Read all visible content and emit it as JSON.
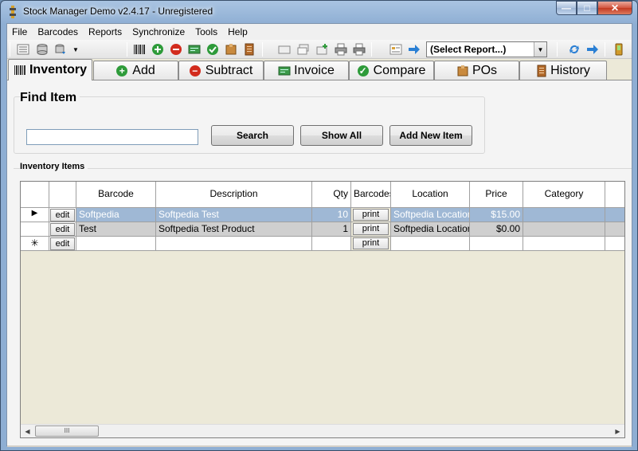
{
  "window": {
    "title": "Stock Manager Demo v2.4.17 - Unregistered",
    "min_label": "—",
    "max_label": "□",
    "close_label": "✕"
  },
  "menu": [
    "File",
    "Barcodes",
    "Reports",
    "Synchronize",
    "Tools",
    "Help"
  ],
  "toolbar": {
    "report_select": "(Select Report...)"
  },
  "tabs": [
    "Inventory",
    "Add",
    "Subtract",
    "Invoice",
    "Compare",
    "POs",
    "History"
  ],
  "find": {
    "title": "Find Item",
    "search_value": "",
    "search_button": "Search",
    "show_all_button": "Show All",
    "add_new_button": "Add New Item"
  },
  "inventory": {
    "title": "Inventory Items",
    "columns": [
      "",
      "",
      "Barcode",
      "Description",
      "Qty",
      "Barcodes",
      "Location",
      "Price",
      "Category"
    ],
    "rows": [
      {
        "marker": "▶",
        "edit": "edit",
        "barcode": "Softpedia",
        "description": "Softpedia Test",
        "qty": "10",
        "print": "print",
        "location": "Softpedia Location",
        "price": "$15.00",
        "category": ""
      },
      {
        "marker": "",
        "edit": "edit",
        "barcode": "Test",
        "description": "Softpedia Test Product",
        "qty": "1",
        "print": "print",
        "location": "Softpedia Location",
        "price": "$0.00",
        "category": ""
      },
      {
        "marker": "✳",
        "edit": "edit",
        "barcode": "",
        "description": "",
        "qty": "",
        "print": "print",
        "location": "",
        "price": "",
        "category": ""
      }
    ]
  },
  "scrollbar": {
    "left": "◀",
    "right": "▶",
    "grip": "III"
  },
  "colors": {
    "selected_row": "#9fb8d5",
    "tab_add": "#2e9b3a",
    "tab_subtract": "#d22b1d",
    "tab_compare": "#2e9b3a"
  }
}
